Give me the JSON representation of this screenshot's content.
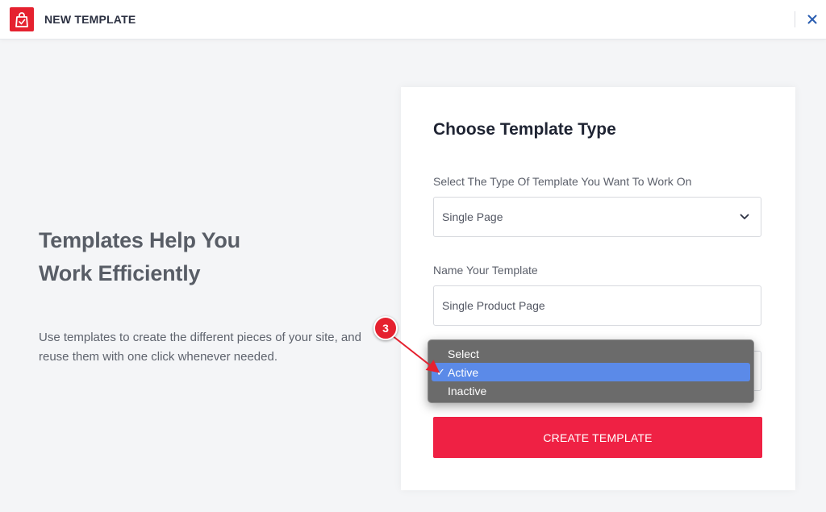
{
  "header": {
    "title": "NEW TEMPLATE",
    "logo_icon": "shopping-bag-icon",
    "close_icon": "close-icon"
  },
  "left_panel": {
    "title_line1": "Templates Help You",
    "title_line2": "Work Efficiently",
    "description": "Use templates to create the different pieces of your site, and reuse them with one click whenever needed."
  },
  "form": {
    "title": "Choose Template Type",
    "type_label": "Select The Type Of Template You Want To Work On",
    "type_value": "Single Page",
    "name_label": "Name Your Template",
    "name_value": "Single Product Page",
    "submit_label": "CREATE TEMPLATE"
  },
  "dropdown": {
    "options": [
      "Select",
      "Active",
      "Inactive"
    ],
    "selected": "Active",
    "check_glyph": "✓"
  },
  "annotation": {
    "step_number": "3"
  },
  "colors": {
    "brand_red": "#e5212f",
    "button_red": "#ef2144",
    "selection_blue": "#5b8ae8",
    "dropdown_gray": "#6b6b6b"
  }
}
